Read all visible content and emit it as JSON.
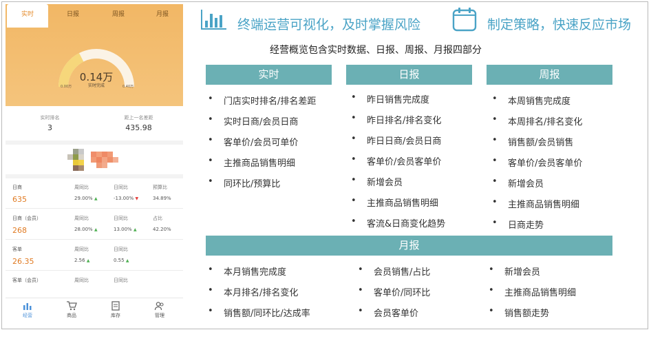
{
  "phone": {
    "tabs": [
      "实时",
      "日报",
      "周报",
      "月报"
    ],
    "gauge": {
      "value": "0.14万",
      "label": "实时完成",
      "min": "0.00万",
      "max": "0.40万",
      "fill_fraction": 0.35
    },
    "ranks": [
      {
        "label": "实时排名",
        "value": "3"
      },
      {
        "label": "距上一名差距",
        "value": "435.98"
      }
    ],
    "metrics": [
      {
        "name": "日商",
        "value": "635",
        "cols": [
          {
            "label": "周同比",
            "value": "29.00%",
            "trend": "up"
          },
          {
            "label": "日同比",
            "value": "-13.00%",
            "trend": "down"
          },
          {
            "label": "预算比",
            "value": "34.89%",
            "trend": ""
          }
        ]
      },
      {
        "name": "日商（会员）",
        "value": "268",
        "cols": [
          {
            "label": "周同比",
            "value": "28.00%",
            "trend": "up"
          },
          {
            "label": "日同比",
            "value": "13.00%",
            "trend": "up"
          },
          {
            "label": "占比",
            "value": "42.20%",
            "trend": ""
          }
        ]
      },
      {
        "name": "客单",
        "value": "26.35",
        "cols": [
          {
            "label": "周同比",
            "value": "2.56",
            "trend": "up"
          },
          {
            "label": "日同比",
            "value": "0.55",
            "trend": "up"
          }
        ]
      },
      {
        "name": "客单（会员）",
        "value": "",
        "cols": [
          {
            "label": "周同比",
            "value": "",
            "trend": ""
          },
          {
            "label": "日同比",
            "value": "",
            "trend": ""
          }
        ]
      }
    ],
    "nav": [
      "经营",
      "商品",
      "库存",
      "管理"
    ],
    "accent_color": "#f2b765"
  },
  "banner": {
    "left_text": "终端运营可视化，及时掌握风险",
    "right_text": "制定策略，快速反应市场",
    "color": "#4aa3c6"
  },
  "subtitle": "经营概览包含实时数据、日报、周报、月报四部分",
  "sections": {
    "realtime": {
      "title": "实时",
      "items": [
        "门店实时排名/排名差距",
        "实时日商/会员日商",
        "客单价/会员可单价",
        "主推商品销售明细",
        "同环比/预算比"
      ]
    },
    "daily": {
      "title": "日报",
      "items": [
        "昨日销售完成度",
        "昨日排名/排名变化",
        "昨日日商/会员日商",
        "客单价/会员客单价",
        "新增会员",
        "主推商品销售明细",
        "客流&日商变化趋势"
      ]
    },
    "weekly": {
      "title": "周报",
      "items": [
        "本周销售完成度",
        "本周排名/排名变化",
        "销售额/会员销售",
        "客单价/会员客单价",
        "新增会员",
        "主推商品销售明细",
        "日商走势"
      ]
    },
    "monthly": {
      "title": "月报",
      "col1": [
        "本月销售完成度",
        "本月排名/排名变化",
        "销售额/同环比/达成率"
      ],
      "col2": [
        "会员销售/占比",
        "客单价/同环比",
        "会员客单价"
      ],
      "col3": [
        "新增会员",
        "主推商品销售明细",
        "销售额走势"
      ]
    }
  },
  "section_color": "#6bb0b4"
}
